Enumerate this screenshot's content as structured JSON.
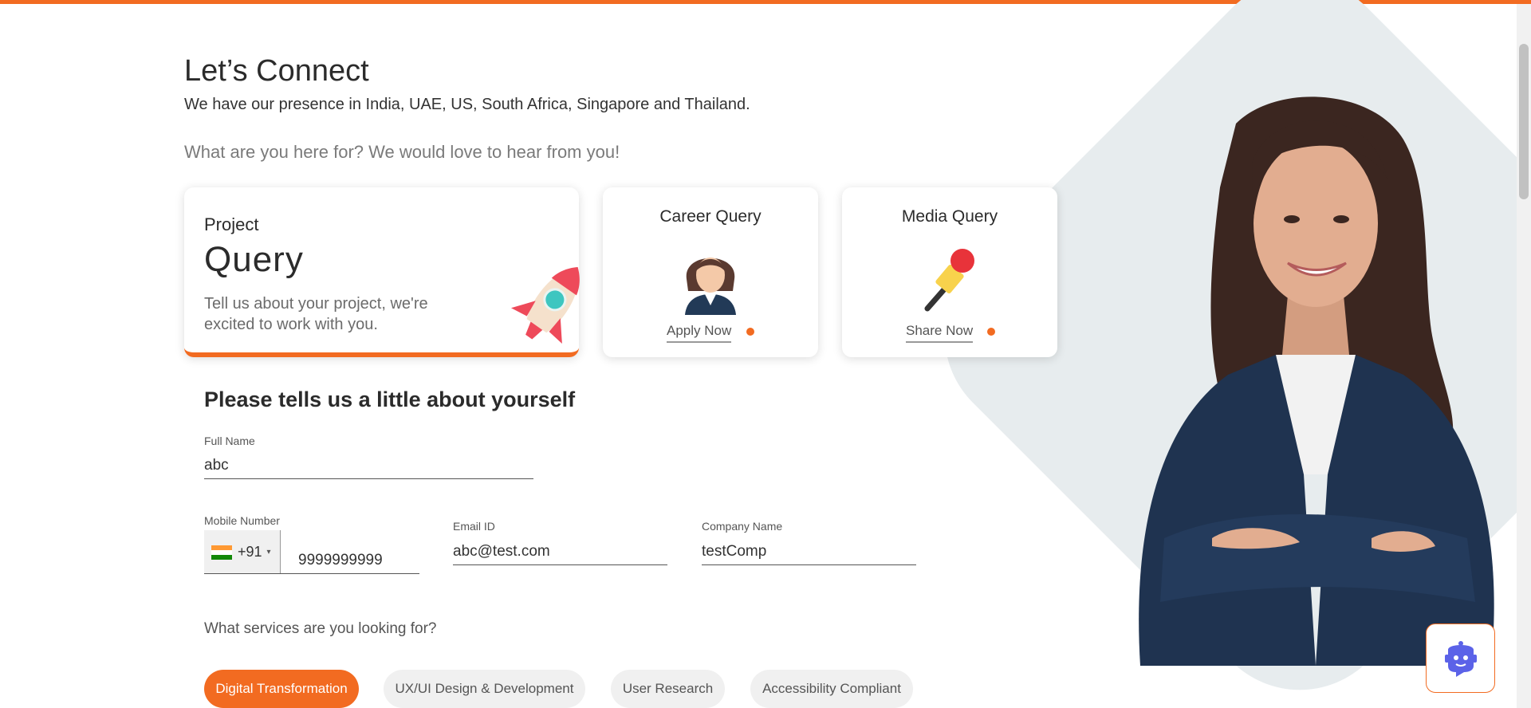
{
  "header": {
    "title": "Let’s Connect",
    "presence": "We have our presence in India, UAE, US, South Africa, Singapore and Thailand.",
    "prompt": "What are you here for? We would love to hear from you!"
  },
  "cards": {
    "project": {
      "kicker": "Project",
      "title": "Query",
      "description": "Tell us about your project, we're excited to work with you.",
      "icon": "rocket-icon"
    },
    "career": {
      "title": "Career Query",
      "link": "Apply Now",
      "icon": "woman-avatar-icon"
    },
    "media": {
      "title": "Media Query",
      "link": "Share Now",
      "icon": "microphone-icon"
    }
  },
  "form": {
    "heading": "Please tells us a little about yourself",
    "full_name": {
      "label": "Full Name",
      "value": "abc"
    },
    "mobile": {
      "label": "Mobile Number",
      "country_code": "+91",
      "country_flag": "india-flag-icon",
      "value": "9999999999"
    },
    "email": {
      "label": "Email ID",
      "value": "abc@test.com"
    },
    "company": {
      "label": "Company Name",
      "value": "testComp"
    },
    "services_question": "What services are you looking for?",
    "services": [
      {
        "label": "Digital Transformation",
        "selected": true
      },
      {
        "label": "UX/UI Design & Development",
        "selected": false
      },
      {
        "label": "User Research",
        "selected": false
      },
      {
        "label": "Accessibility Compliant",
        "selected": false
      }
    ]
  },
  "chat": {
    "icon": "chatbot-icon"
  },
  "colors": {
    "accent": "#f26b21",
    "chip_bg": "#f0f0f0",
    "bg_shape": "#e7ecee",
    "chat_icon": "#5b62e8"
  }
}
